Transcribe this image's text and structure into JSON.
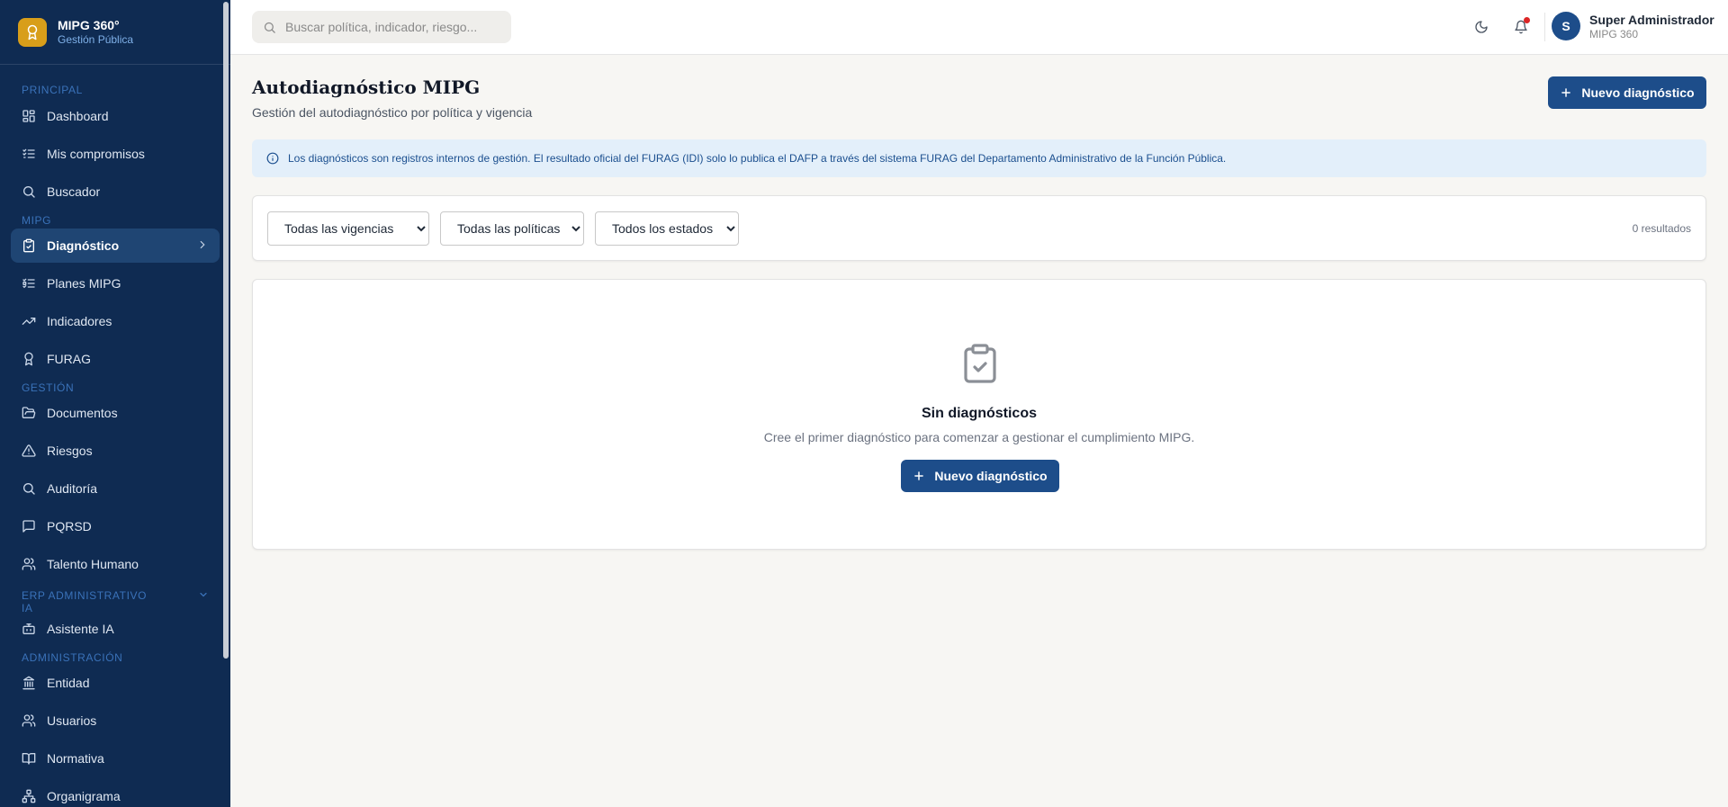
{
  "brand": {
    "name": "MIPG 360°",
    "subtitle": "Gestión Pública"
  },
  "sidebar": {
    "sections": {
      "principal": "PRINCIPAL",
      "mipg": "MIPG",
      "gestion": "GESTIÓN",
      "erp": "ERP ADMINISTRATIVO IA",
      "admin": "ADMINISTRACIÓN"
    },
    "items": {
      "dashboard": "Dashboard",
      "compromisos": "Mis compromisos",
      "buscador": "Buscador",
      "diagnostico": "Diagnóstico",
      "planes": "Planes MIPG",
      "indicadores": "Indicadores",
      "furag": "FURAG",
      "documentos": "Documentos",
      "riesgos": "Riesgos",
      "auditoria": "Auditoría",
      "pqrsd": "PQRSD",
      "talento": "Talento Humano",
      "asistente": "Asistente IA",
      "entidad": "Entidad",
      "usuarios": "Usuarios",
      "normativa": "Normativa",
      "organigrama": "Organigrama"
    }
  },
  "topbar": {
    "search_placeholder": "Buscar política, indicador, riesgo...",
    "user_initial": "S",
    "user_name": "Super Administrador",
    "user_role": "MIPG 360"
  },
  "page": {
    "title": "Autodiagnóstico MIPG",
    "subtitle": "Gestión del autodiagnóstico por política y vigencia",
    "new_button": "Nuevo diagnóstico",
    "alert": "Los diagnósticos son registros internos de gestión. El resultado oficial del FURAG (IDI) solo lo publica el DAFP a través del sistema FURAG del Departamento Administrativo de la Función Pública."
  },
  "filters": {
    "vigencia": "Todas las vigencias",
    "politica": "Todas las políticas",
    "estado": "Todos los estados",
    "results": "0 resultados"
  },
  "empty": {
    "title": "Sin diagnósticos",
    "description": "Cree el primer diagnóstico para comenzar a gestionar el cumplimiento MIPG.",
    "button": "Nuevo diagnóstico"
  }
}
